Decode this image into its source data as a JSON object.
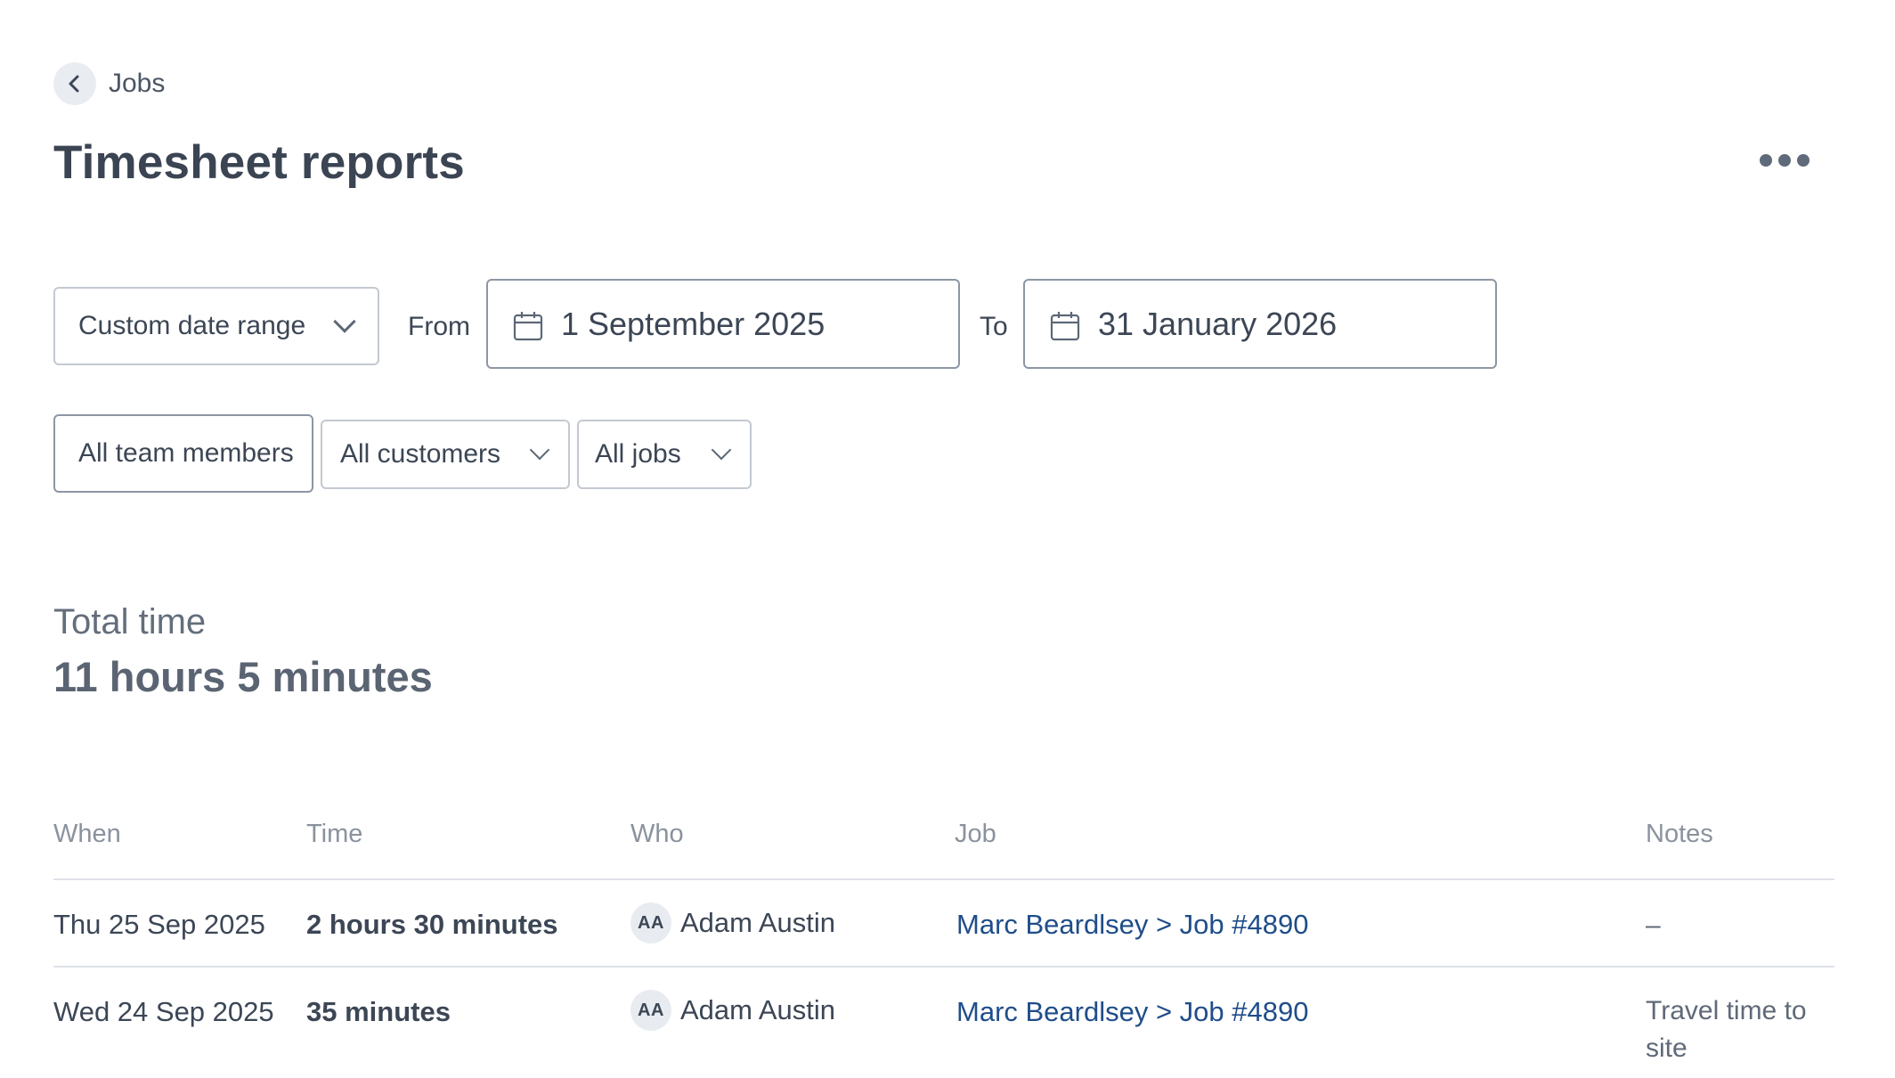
{
  "breadcrumb": {
    "label": "Jobs"
  },
  "page": {
    "title": "Timesheet reports"
  },
  "filters": {
    "date_range": "Custom date range",
    "from_label": "From",
    "from_date": "1 September 2025",
    "to_label": "To",
    "to_date": "31 January 2026",
    "team": "All team members",
    "customers": "All customers",
    "jobs": "All jobs"
  },
  "summary": {
    "label": "Total time",
    "value": "11 hours 5 minutes"
  },
  "table": {
    "headers": {
      "when": "When",
      "time": "Time",
      "who": "Who",
      "job": "Job",
      "notes": "Notes"
    },
    "rows": [
      {
        "when": "Thu 25 Sep 2025",
        "time": "2 hours 30 minutes",
        "initials": "AA",
        "who": "Adam Austin",
        "job": "Marc Beardlsey > Job #4890",
        "notes": "–"
      },
      {
        "when": "Wed 24 Sep 2025",
        "time": "35 minutes",
        "initials": "AA",
        "who": "Adam Austin",
        "job": "Marc Beardlsey > Job #4890",
        "notes": "Travel time to site"
      }
    ]
  },
  "icons": {
    "back": "chevron-left-icon",
    "more": "more-horizontal-icon",
    "calendar": "calendar-icon",
    "dropdown": "chevron-down-icon"
  },
  "colors": {
    "link": "#1f4d8a",
    "text": "#3c4655",
    "muted": "#8a929d",
    "border": "#c3c9d1"
  }
}
